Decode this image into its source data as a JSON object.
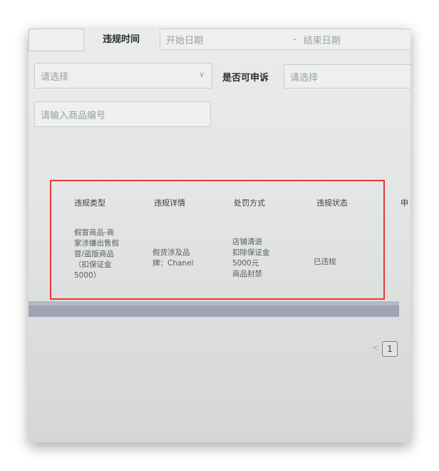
{
  "filters": {
    "violation_time_label": "违规时间",
    "start_date_placeholder": "开始日期",
    "date_separator": "-",
    "end_date_placeholder": "结束日期",
    "select_placeholder_1": "请选择",
    "appeal_label": "是否可申诉",
    "select_placeholder_2": "请选择",
    "product_id_placeholder": "请输入商品编号"
  },
  "table": {
    "headers": [
      "违规类型",
      "违规详情",
      "处罚方式",
      "违规状态",
      "申"
    ],
    "row": {
      "type_lines": [
        "假冒商品-商",
        "家涉嫌出售假",
        "冒/盗版商品",
        "（扣保证金",
        "5000）"
      ],
      "detail_lines": [
        "假货涉及品",
        "牌：Chanel"
      ],
      "penalty_lines": [
        "店铺清退",
        "扣除保证金",
        "5000元",
        "商品封禁"
      ],
      "status": "已违规"
    }
  },
  "pagination": {
    "current_page": "1",
    "prev_symbol": "<"
  },
  "colors": {
    "highlight_border": "#e23a3a",
    "scrollbar": "#9ea4b2"
  }
}
